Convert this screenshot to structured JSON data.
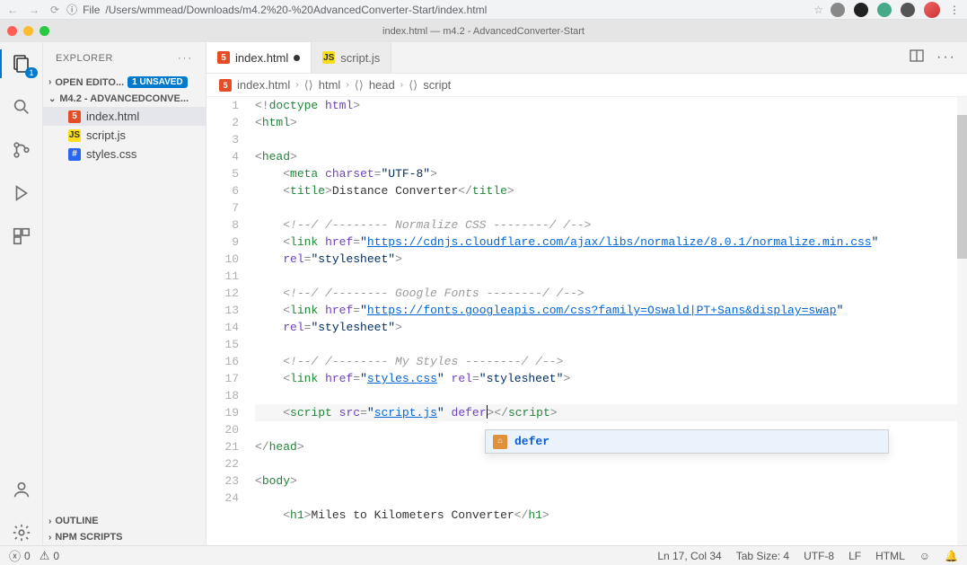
{
  "browser": {
    "url_prefix": "File",
    "url_path": "/Users/wmmead/Downloads/m4.2%20-%20AdvancedConverter-Start/index.html"
  },
  "window": {
    "title": "index.html — m4.2 - AdvancedConverter-Start"
  },
  "activity": {
    "explorer_badge": "1"
  },
  "sidebar": {
    "title": "EXPLORER",
    "open_editors_label": "OPEN EDITO...",
    "unsaved_badge": "1 UNSAVED",
    "folder_label": "M4.2 - ADVANCEDCONVE...",
    "files": [
      {
        "name": "index.html",
        "icon": "html"
      },
      {
        "name": "script.js",
        "icon": "js"
      },
      {
        "name": "styles.css",
        "icon": "css"
      }
    ],
    "outline_label": "OUTLINE",
    "npm_label": "NPM SCRIPTS"
  },
  "tabs": [
    {
      "name": "index.html",
      "icon": "html",
      "dirty": true,
      "active": true
    },
    {
      "name": "script.js",
      "icon": "js",
      "dirty": false,
      "active": false
    }
  ],
  "breadcrumb": {
    "file": "index.html",
    "p1": "html",
    "p2": "head",
    "p3": "script"
  },
  "code": {
    "lines": [
      "1",
      "2",
      "3",
      "4",
      "5",
      "6",
      "7",
      "8",
      "9",
      "10",
      "11",
      "12",
      "13",
      "14",
      "15",
      "16",
      "17",
      "18",
      "19",
      "20",
      "21",
      "22",
      "23",
      "24"
    ],
    "title_text": "Distance Converter",
    "comment_normalize": "<!--/ /-------- Normalize CSS --------/ /-->",
    "link_normalize_href": "https://cdnjs.cloudflare.com/ajax/libs/normalize/8.0.1/normalize.min.css",
    "rel_stylesheet": "stylesheet",
    "comment_fonts": "<!--/ /-------- Google Fonts --------/ /-->",
    "link_fonts_href": "https://fonts.googleapis.com/css?family=Oswald|PT+Sans&display=swap",
    "comment_mystyles": "<!--/ /-------- My Styles --------/ /-->",
    "link_styles_href": "styles.css",
    "script_src": "script.js",
    "script_attr": "defer",
    "h1_text": "Miles to Kilometers Converter"
  },
  "autocomplete": {
    "item": "defer"
  },
  "status": {
    "errors": "0",
    "warnings": "0",
    "lncol": "Ln 17, Col 34",
    "spaces": "Tab Size: 4",
    "encoding": "UTF-8",
    "eol": "LF",
    "lang": "HTML"
  }
}
